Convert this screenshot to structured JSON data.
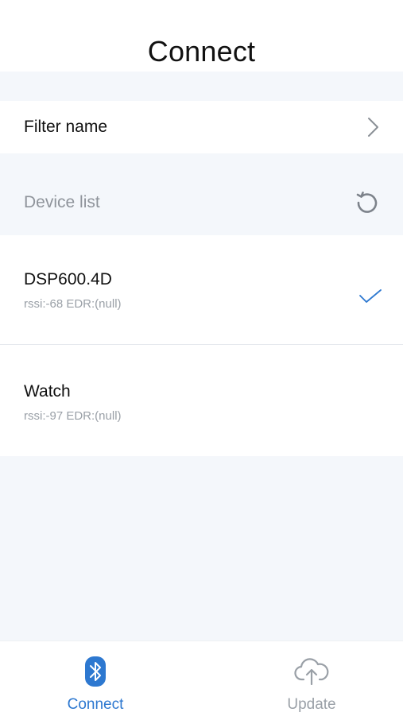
{
  "header": {
    "title": "Connect"
  },
  "filter": {
    "label": "Filter name",
    "chevron_icon": "chevron-right-icon"
  },
  "device_list": {
    "label": "Device list",
    "refresh_icon": "refresh-icon",
    "devices": [
      {
        "name": "DSP600.4D",
        "meta": "rssi:-68 EDR:(null)",
        "selected": true
      },
      {
        "name": "Watch",
        "meta": "rssi:-97 EDR:(null)",
        "selected": false
      }
    ]
  },
  "tabbar": {
    "tabs": [
      {
        "label": "Connect",
        "icon": "bluetooth-icon",
        "active": true
      },
      {
        "label": "Update",
        "icon": "cloud-upload-icon",
        "active": false
      }
    ]
  },
  "colors": {
    "accent": "#2d78d0",
    "background": "#f4f7fb",
    "muted_text": "#9aa0a7"
  }
}
